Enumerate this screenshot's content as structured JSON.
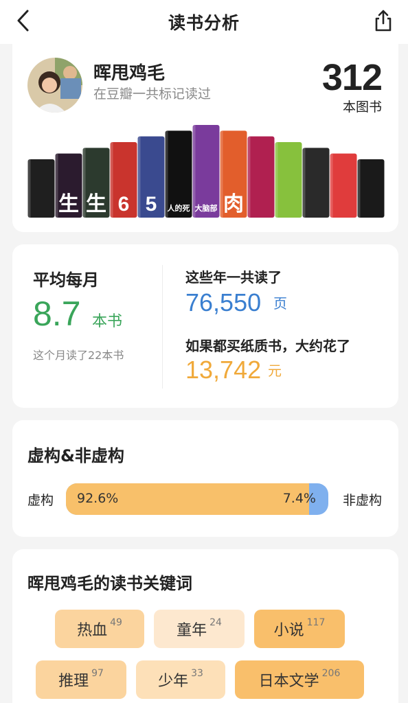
{
  "header": {
    "title": "读书分析",
    "back_icon": "back-chevron-icon",
    "share_icon": "share-icon"
  },
  "profile": {
    "username": "晖甩鸡毛",
    "subtitle": "在豆瓣一共标记读过",
    "count": "312",
    "count_unit": "本图书"
  },
  "books": [
    {
      "color": "#1f1f1f",
      "text": ""
    },
    {
      "color": "#2b1b2e",
      "text": "生"
    },
    {
      "color": "#2c3a2e",
      "text": "生"
    },
    {
      "color": "#c9342d",
      "text": "6"
    },
    {
      "color": "#3a4a8f",
      "text": "5"
    },
    {
      "color": "#111111",
      "text": "人的死亡"
    },
    {
      "color": "#7a3b9c",
      "text": "大脑部也被侵占"
    },
    {
      "color": "#e25e2c",
      "text": "肉"
    },
    {
      "color": "#b02050",
      "text": ""
    },
    {
      "color": "#87c13d",
      "text": ""
    },
    {
      "color": "#2a2a2a",
      "text": ""
    },
    {
      "color": "#e03c3c",
      "text": ""
    },
    {
      "color": "#1a1a1a",
      "text": ""
    }
  ],
  "stats": {
    "left_label": "平均每月",
    "left_num": "8.7",
    "left_unit": "本书",
    "left_note": "这个月读了22本书",
    "r1_label": "这些年一共读了",
    "r1_num": "76,550",
    "r1_unit": "页",
    "r2_label": "如果都买纸质书，大约花了",
    "r2_num": "13,742",
    "r2_unit": "元"
  },
  "fiction": {
    "title": "虚构&非虚构",
    "left_label": "虚构",
    "right_label": "非虚构",
    "fiction_pct_text": "92.6%",
    "nonfiction_pct_text": "7.4%",
    "fiction_fraction": 0.926
  },
  "keywords": {
    "title": "晖甩鸡毛的读书关键词",
    "items": [
      {
        "label": "热血",
        "count": "49"
      },
      {
        "label": "童年",
        "count": "24"
      },
      {
        "label": "小说",
        "count": "117"
      },
      {
        "label": "推理",
        "count": "97"
      },
      {
        "label": "少年",
        "count": "33"
      },
      {
        "label": "日本文学",
        "count": "206"
      }
    ]
  },
  "colors": {
    "green": "#3aa55a",
    "blue": "#3a7fd0",
    "orange": "#f0a93a"
  }
}
